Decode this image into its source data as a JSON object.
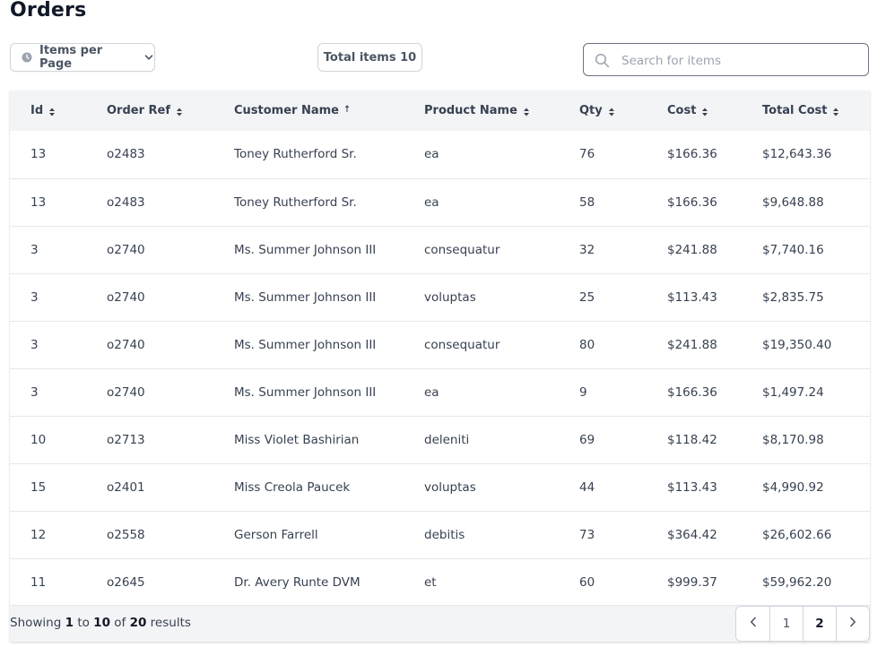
{
  "page": {
    "title": "Orders"
  },
  "toolbar": {
    "per_page_label": "Items per Page",
    "per_page_icon": "clock-icon",
    "total_label": "Total items 10",
    "search_placeholder": "Search for items"
  },
  "table": {
    "columns": [
      {
        "label": "Id",
        "sort": "both"
      },
      {
        "label": "Order Ref",
        "sort": "both"
      },
      {
        "label": "Customer Name",
        "sort": "asc"
      },
      {
        "label": "Product Name",
        "sort": "both"
      },
      {
        "label": "Qty",
        "sort": "both"
      },
      {
        "label": "Cost",
        "sort": "both"
      },
      {
        "label": "Total Cost",
        "sort": "both"
      }
    ],
    "rows": [
      [
        "13",
        "o2483",
        "Toney Rutherford Sr.",
        "ea",
        "76",
        "$166.36",
        "$12,643.36"
      ],
      [
        "13",
        "o2483",
        "Toney Rutherford Sr.",
        "ea",
        "58",
        "$166.36",
        "$9,648.88"
      ],
      [
        "3",
        "o2740",
        "Ms. Summer Johnson III",
        "consequatur",
        "32",
        "$241.88",
        "$7,740.16"
      ],
      [
        "3",
        "o2740",
        "Ms. Summer Johnson III",
        "voluptas",
        "25",
        "$113.43",
        "$2,835.75"
      ],
      [
        "3",
        "o2740",
        "Ms. Summer Johnson III",
        "consequatur",
        "80",
        "$241.88",
        "$19,350.40"
      ],
      [
        "3",
        "o2740",
        "Ms. Summer Johnson III",
        "ea",
        "9",
        "$166.36",
        "$1,497.24"
      ],
      [
        "10",
        "o2713",
        "Miss Violet Bashirian",
        "deleniti",
        "69",
        "$118.42",
        "$8,170.98"
      ],
      [
        "15",
        "o2401",
        "Miss Creola Paucek",
        "voluptas",
        "44",
        "$113.43",
        "$4,990.92"
      ],
      [
        "12",
        "o2558",
        "Gerson Farrell",
        "debitis",
        "73",
        "$364.42",
        "$26,602.66"
      ],
      [
        "11",
        "o2645",
        "Dr. Avery Runte DVM",
        "et",
        "60",
        "$999.37",
        "$59,962.20"
      ]
    ]
  },
  "footer": {
    "showing_prefix": "Showing",
    "from": "1",
    "to_word": "to",
    "to": "10",
    "of_word": "of",
    "total": "20",
    "results_word": "results"
  },
  "pagination": {
    "prev_icon": "chevron-left-icon",
    "pages": [
      "1",
      "2"
    ],
    "current_page": "2",
    "next_icon": "chevron-right-icon"
  }
}
